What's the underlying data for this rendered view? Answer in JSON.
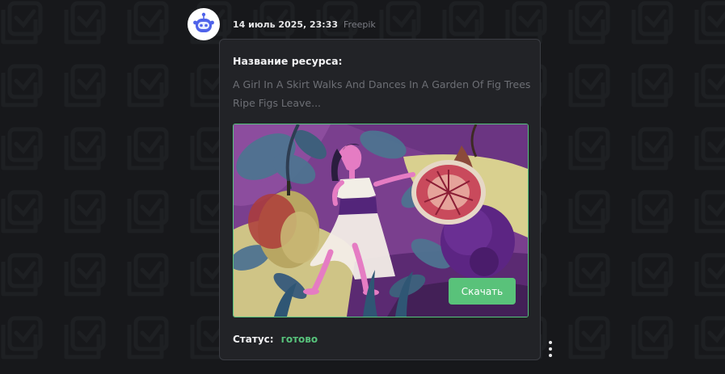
{
  "message": {
    "timestamp": "14 июль 2025, 23:33",
    "source": "Freepik",
    "avatar_icon": "robot-icon"
  },
  "card": {
    "resource_label": "Название ресурса:",
    "resource_title": "A Girl In A Skirt Walks And Dances In A Garden Of Fig Trees Ripe Figs Leave...",
    "download_label": "Скачать",
    "status_label": "Статус:",
    "status_value": "готово"
  },
  "colors": {
    "accent_green": "#59c27a",
    "background": "#17181b",
    "card_bg": "#222327"
  },
  "icons": [
    "robot-icon",
    "more-vertical-icon",
    "check-frame-pattern"
  ]
}
